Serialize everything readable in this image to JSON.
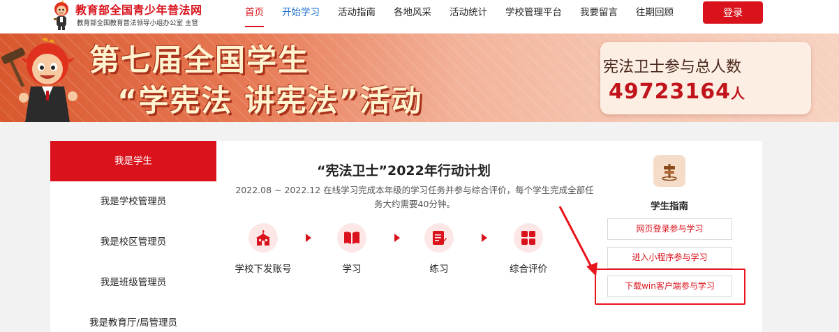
{
  "header": {
    "site_title": "教育部全国青少年普法网",
    "site_subtitle": "教育部全国教育普法领导小组办公室 主管",
    "nav": [
      {
        "label": "首页"
      },
      {
        "label": "开始学习"
      },
      {
        "label": "活动指南"
      },
      {
        "label": "各地风采"
      },
      {
        "label": "活动统计"
      },
      {
        "label": "学校管理平台"
      },
      {
        "label": "我要留言"
      },
      {
        "label": "往期回顾"
      }
    ],
    "login_label": "登录"
  },
  "banner": {
    "line1": "第七届全国学生",
    "line2": "“学宪法 讲宪法”活动",
    "counter_label": "宪法卫士参与总人数",
    "counter_value": "49723164",
    "counter_unit": "人"
  },
  "sidebar": {
    "items": [
      {
        "label": "我是学生"
      },
      {
        "label": "我是学校管理员"
      },
      {
        "label": "我是校区管理员"
      },
      {
        "label": "我是班级管理员"
      },
      {
        "label": "我是教育厅/局管理员"
      }
    ]
  },
  "main": {
    "title": "“宪法卫士”2022年行动计划",
    "desc": "2022.08 ~ 2022.12 在线学习完成本年级的学习任务并参与综合评价，每个学生完成全部任务大约需要40分钟。",
    "steps": [
      {
        "label": "学校下发账号",
        "icon": "school-icon"
      },
      {
        "label": "学习",
        "icon": "book-icon"
      },
      {
        "label": "练习",
        "icon": "exercise-icon"
      },
      {
        "label": "综合评价",
        "icon": "grid-icon"
      }
    ]
  },
  "guide": {
    "title": "学生指南",
    "icon": "signpost-icon",
    "buttons": [
      {
        "label": "网页登录参与学习"
      },
      {
        "label": "进入小程序参与学习"
      },
      {
        "label": "下载win客户端参与学习"
      }
    ]
  },
  "colors": {
    "brand_red": "#d9121b",
    "nav_blue": "#1f6fcf",
    "annotation_red": "#e8141b"
  }
}
